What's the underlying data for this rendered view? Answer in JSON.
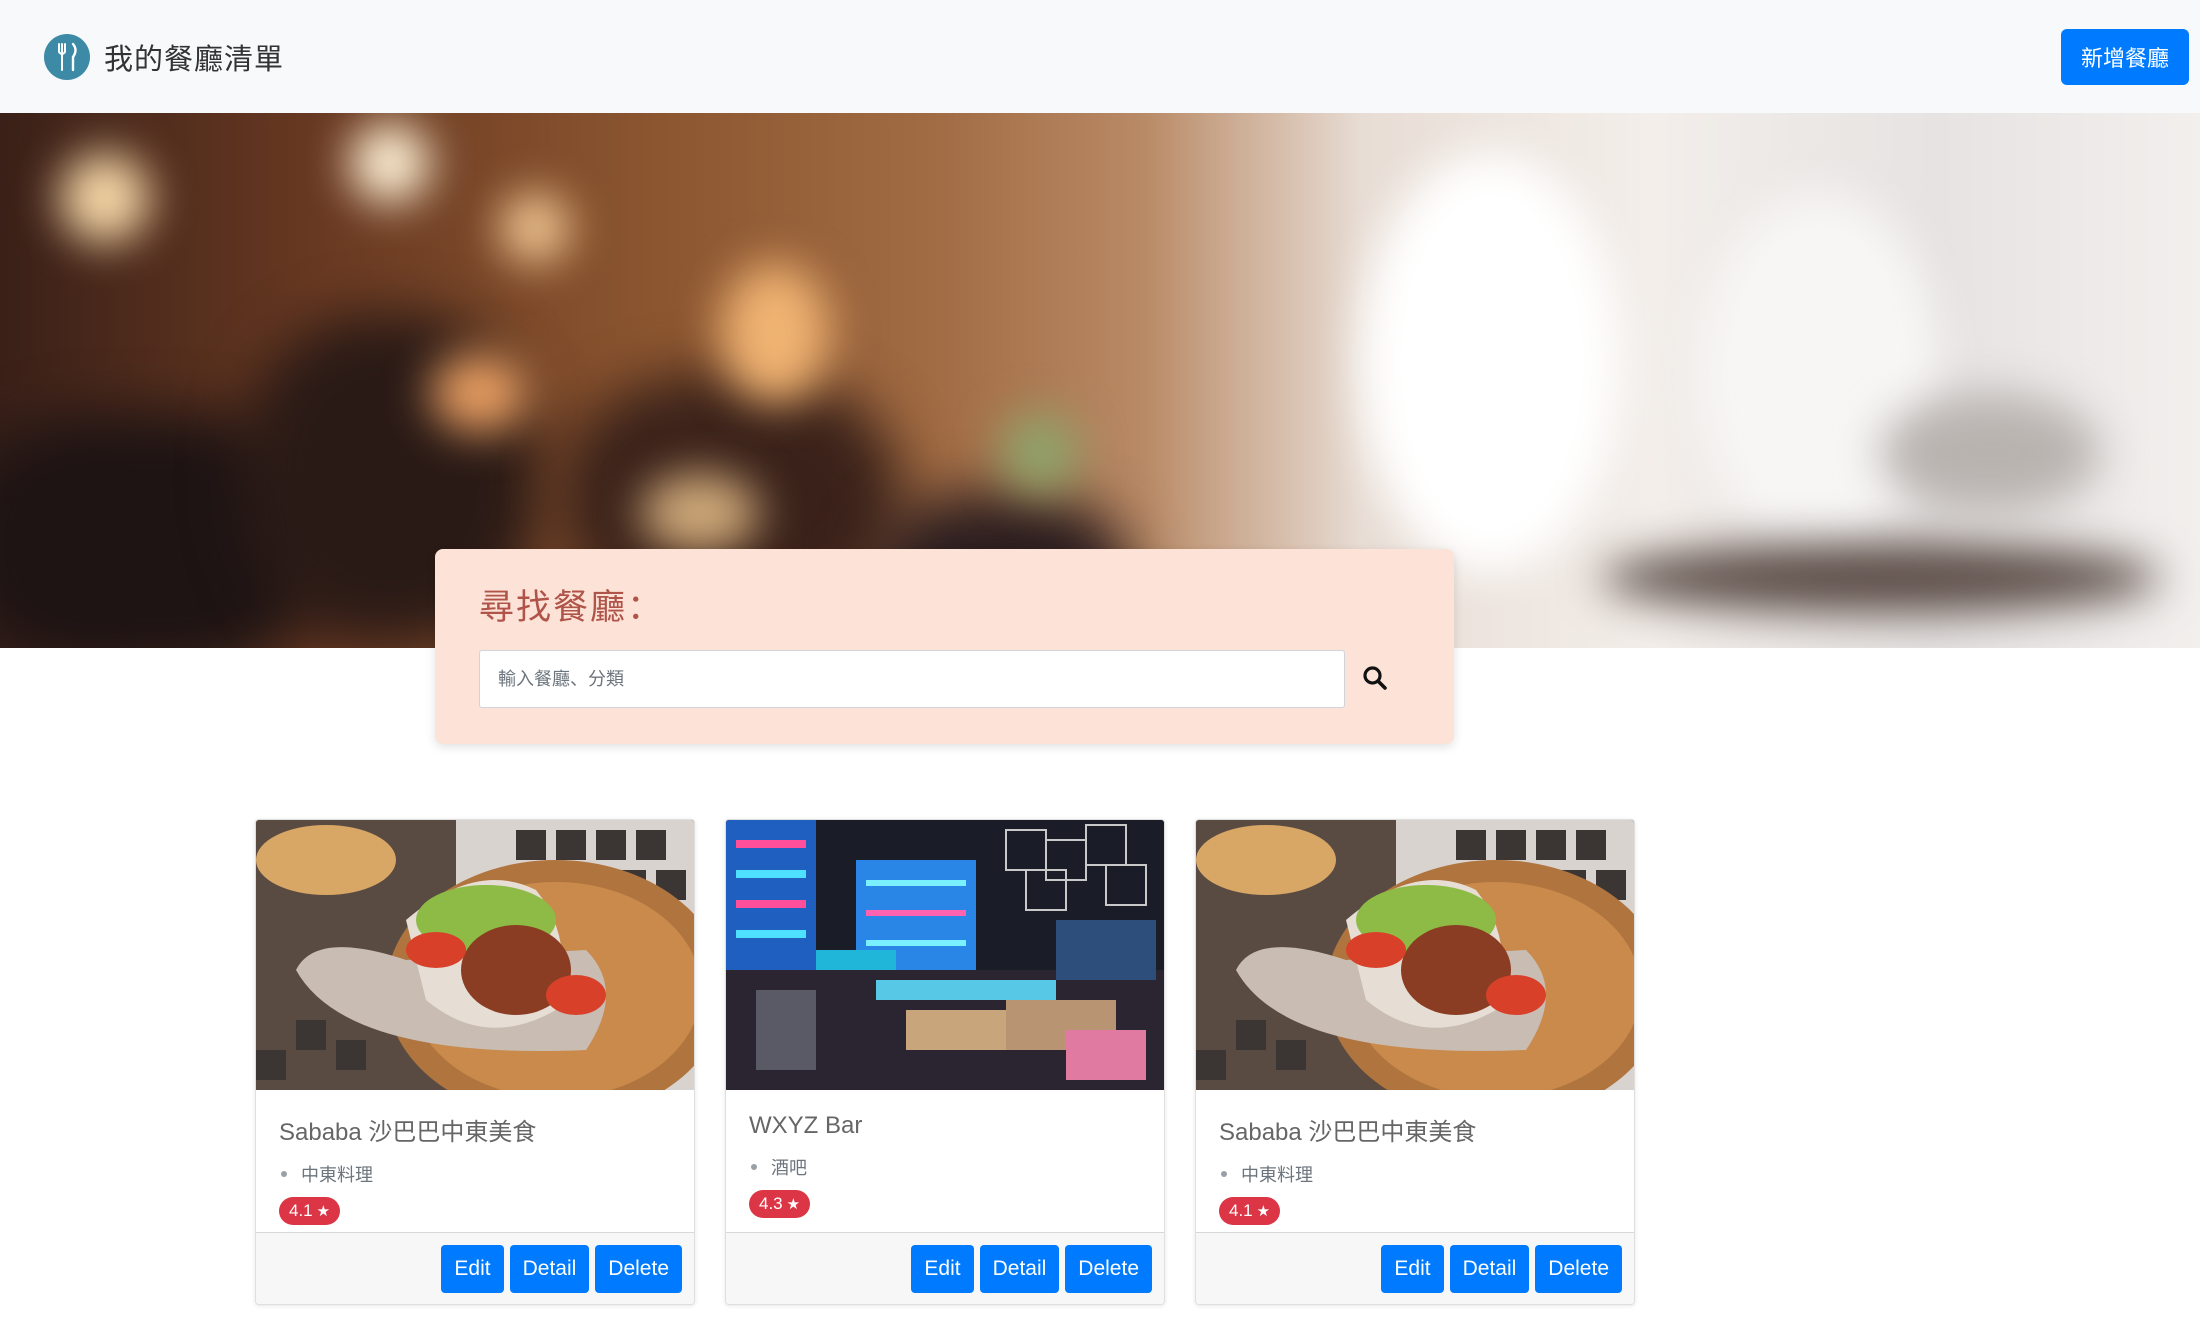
{
  "navbar": {
    "brand_title": "我的餐廳清單",
    "logo_icon": "utensils-icon",
    "new_button": "新增餐廳"
  },
  "search": {
    "title": "尋找餐廳：",
    "placeholder": "輸入餐廳、分類",
    "value": "",
    "button_icon": "search-icon"
  },
  "restaurants": [
    {
      "name": "Sababa 沙巴巴中東美食",
      "category": "中東料理",
      "rating": "4.1",
      "image": "pita-wrap-photo"
    },
    {
      "name": "WXYZ Bar",
      "category": "酒吧",
      "rating": "4.3",
      "image": "bar-interior-photo"
    },
    {
      "name": "Sababa 沙巴巴中東美食",
      "category": "中東料理",
      "rating": "4.1",
      "image": "pita-wrap-photo"
    }
  ],
  "card_actions": {
    "edit": "Edit",
    "detail": "Detail",
    "delete": "Delete"
  },
  "colors": {
    "primary": "#007bff",
    "badge": "#dc3545",
    "search_bg": "#fde3d7",
    "search_title": "#b0544a",
    "navbar_bg": "#f8f9fa"
  }
}
